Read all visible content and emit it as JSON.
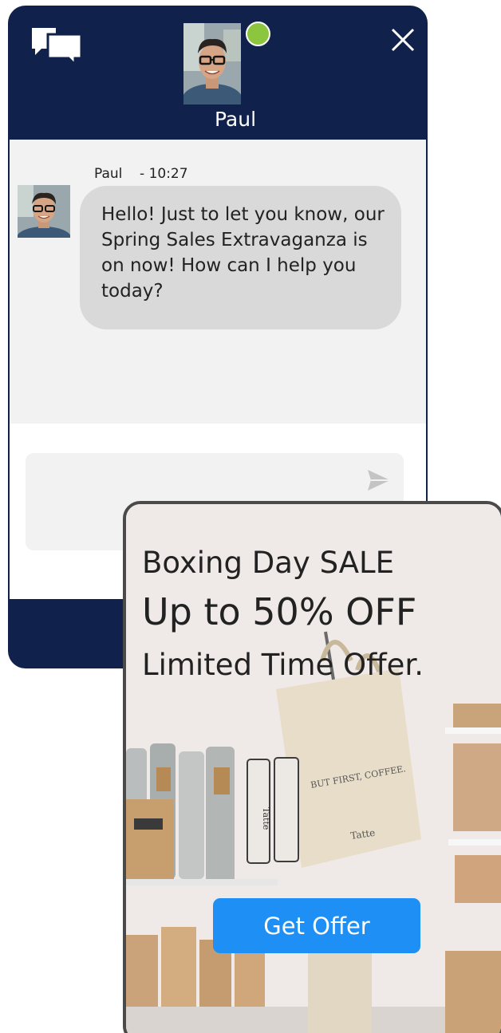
{
  "chat": {
    "agent_name": "Paul",
    "agent_status": "online",
    "message": {
      "sender": "Paul",
      "time": "- 10:27",
      "text": "Hello! Just to let you know, our Spring Sales Extravaganza is on now! How can I help you today?"
    },
    "input": {
      "value": "",
      "placeholder": ""
    }
  },
  "promo": {
    "line1": "Boxing Day SALE",
    "line2": "Up to 50% OFF",
    "line3": "Limited Time Offer.",
    "cta_label": "Get Offer",
    "bag_print": "BUT FIRST, COFFEE.",
    "bag_brand": "Tatte",
    "jar_label": "Tatte"
  },
  "colors": {
    "header_bg": "#10224b",
    "online": "#8cc63f",
    "bubble_bg": "#d9d9d9",
    "cta_bg": "#1e8ff5"
  },
  "icons": {
    "conversation": "chat-bubbles-icon",
    "close": "close-icon",
    "send": "send-icon"
  }
}
